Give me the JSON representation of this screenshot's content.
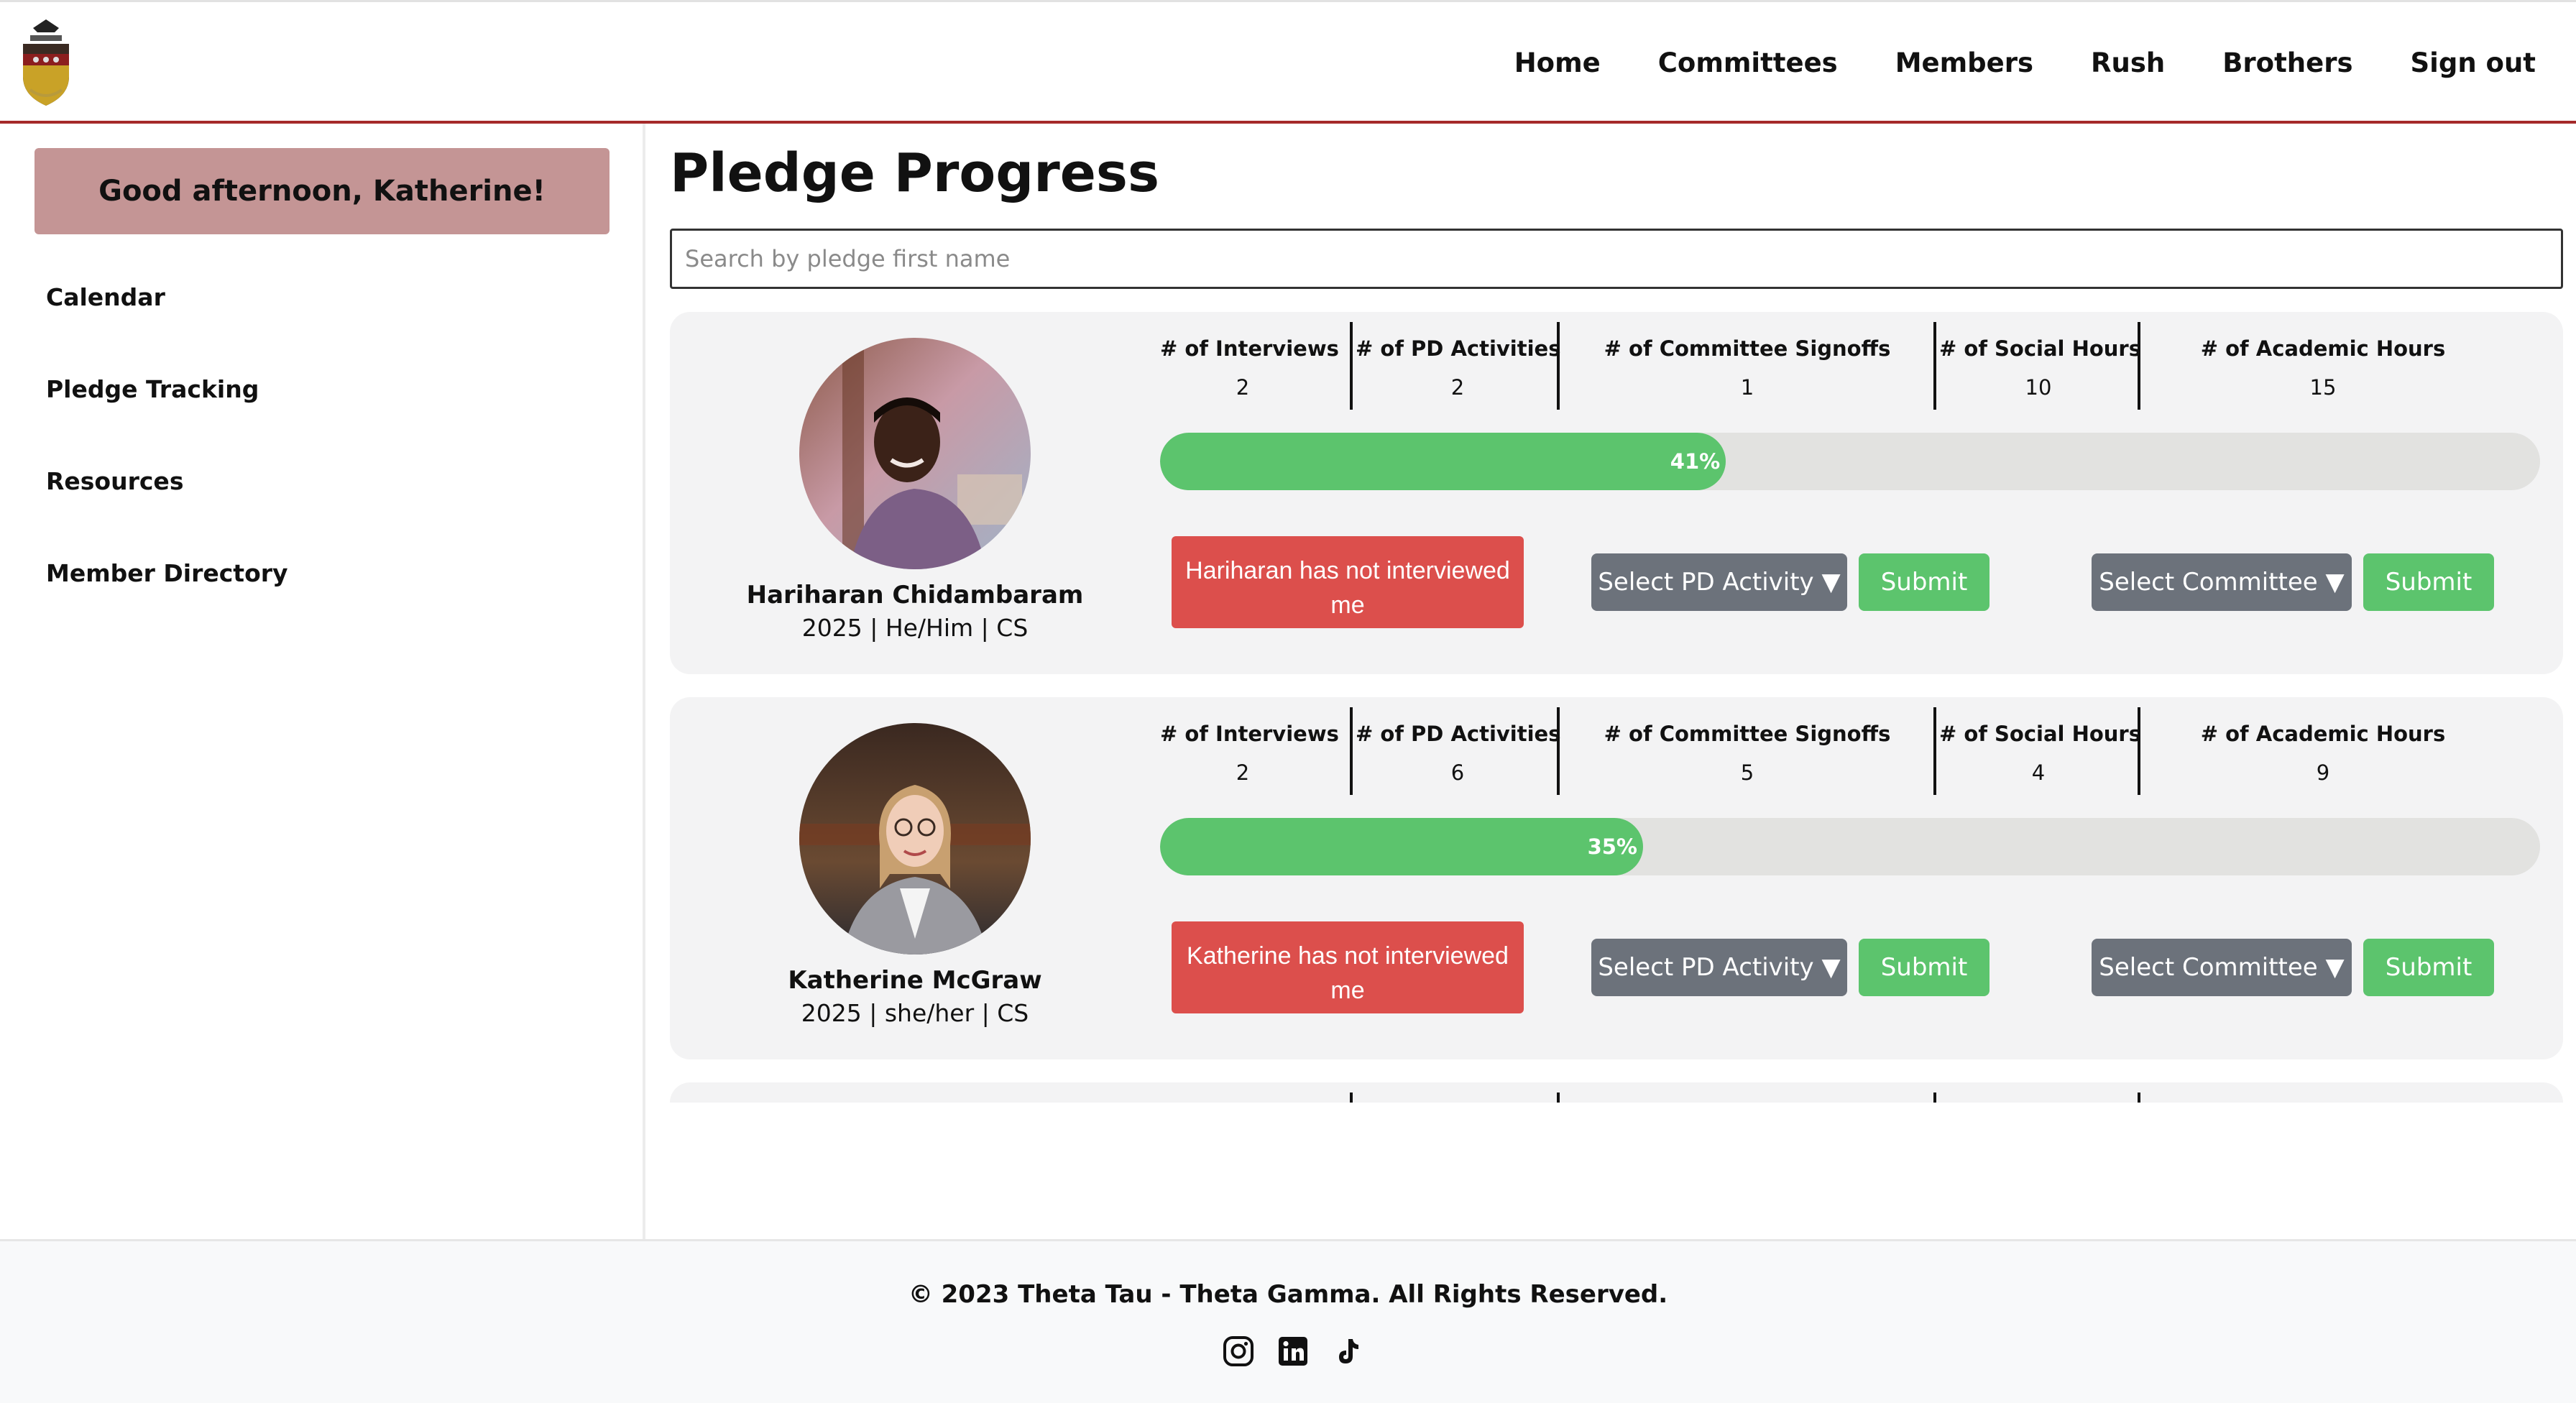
{
  "nav": {
    "items": [
      "Home",
      "Committees",
      "Members",
      "Rush",
      "Brothers",
      "Sign out"
    ]
  },
  "sidebar": {
    "greeting": "Good afternoon, Katherine!",
    "items": [
      "Calendar",
      "Pledge Tracking",
      "Resources",
      "Member Directory"
    ]
  },
  "main": {
    "title": "Pledge Progress",
    "search_placeholder": "Search by pledge first name",
    "stat_labels": [
      "# of Interviews",
      "# of PD Activities",
      "# of Committee Signoffs",
      "# of Social Hours",
      "# of Academic Hours"
    ],
    "pd_select": "Select PD Activity ▼",
    "committee_select": "Select Committee ▼",
    "submit": "Submit",
    "pledges": [
      {
        "name": "Hariharan Chidambaram",
        "meta": "2025 | He/Him | CS",
        "stats": [
          "2",
          "2",
          "1",
          "10",
          "15"
        ],
        "progress": 41,
        "progress_label": "41%",
        "interview_status": "Hariharan has not interviewed me"
      },
      {
        "name": "Katherine McGraw",
        "meta": "2025 | she/her | CS",
        "stats": [
          "2",
          "6",
          "5",
          "4",
          "9"
        ],
        "progress": 35,
        "progress_label": "35%",
        "interview_status": "Katherine has not interviewed me"
      }
    ]
  },
  "footer": {
    "copyright": "© 2023 Theta Tau - Theta Gamma. All Rights Reserved.",
    "socials": [
      "instagram-icon",
      "linkedin-icon",
      "tiktok-icon"
    ]
  },
  "colors": {
    "accent": "#a52a2a",
    "greeting_bg": "#c49595",
    "progress": "#5cc46d",
    "alert": "#dc4f4c",
    "select": "#6c727b"
  }
}
